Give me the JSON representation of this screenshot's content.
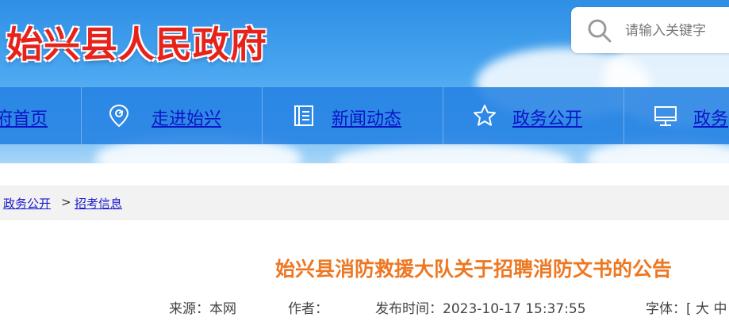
{
  "site": {
    "title": "始兴县人民政府"
  },
  "search": {
    "placeholder": "请输入关键字"
  },
  "nav": [
    {
      "label": "府首页",
      "icon": "home-icon"
    },
    {
      "label": "走进始兴",
      "icon": "location-pin-icon"
    },
    {
      "label": "新闻动态",
      "icon": "news-document-icon"
    },
    {
      "label": "政务公开",
      "icon": "star-icon"
    },
    {
      "label": "政务",
      "icon": "monitor-icon"
    }
  ],
  "breadcrumb": {
    "items": [
      "政务公开",
      "招考信息"
    ],
    "separator": ">"
  },
  "article": {
    "title": "始兴县消防救援大队关于招聘消防文书的公告",
    "source": "来源：本网",
    "author": "作者：",
    "published": "发布时间：2023-10-17 15:37:55",
    "font_size_label": "字体：[ 大  中"
  },
  "colors": {
    "title_red": "#e6231b",
    "nav_blue": "#2482e2",
    "link_blue": "#0a14c8",
    "article_title_orange": "#ee7722",
    "breadcrumb_bg": "#f2f2f2"
  }
}
